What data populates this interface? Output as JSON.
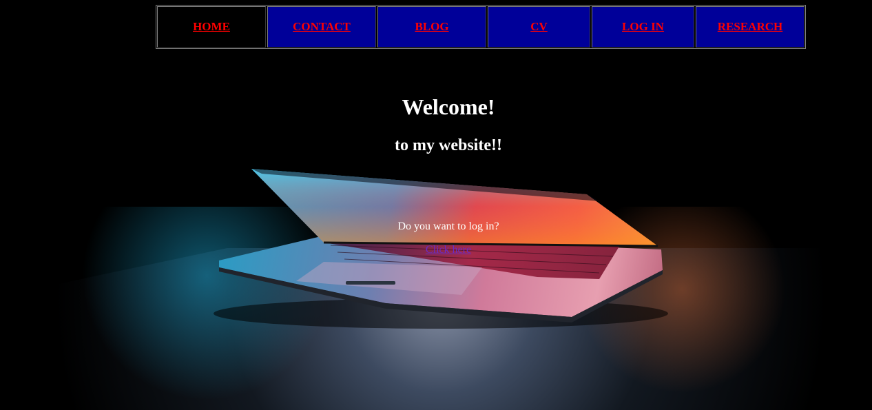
{
  "nav": {
    "items": [
      {
        "label": "HOME",
        "active": true
      },
      {
        "label": "CONTACT",
        "active": false
      },
      {
        "label": "BLOG",
        "active": false
      },
      {
        "label": "CV",
        "active": false
      },
      {
        "label": "LOG IN",
        "active": false
      },
      {
        "label": "RESEARCH",
        "active": false
      }
    ]
  },
  "hero": {
    "title": "Welcome!",
    "subtitle": "to my website!!"
  },
  "login_prompt": {
    "question": "Do you want to log in?",
    "link_label": "Click here"
  },
  "colors": {
    "page_background": "#000000",
    "nav_cell_background": "#000099",
    "nav_active_background": "#000000",
    "nav_link": "#ff0000",
    "heading_text": "#ffffff",
    "visited_link": "#6a2bc4"
  },
  "background_image": "laptop-half-open-glowing-screen"
}
